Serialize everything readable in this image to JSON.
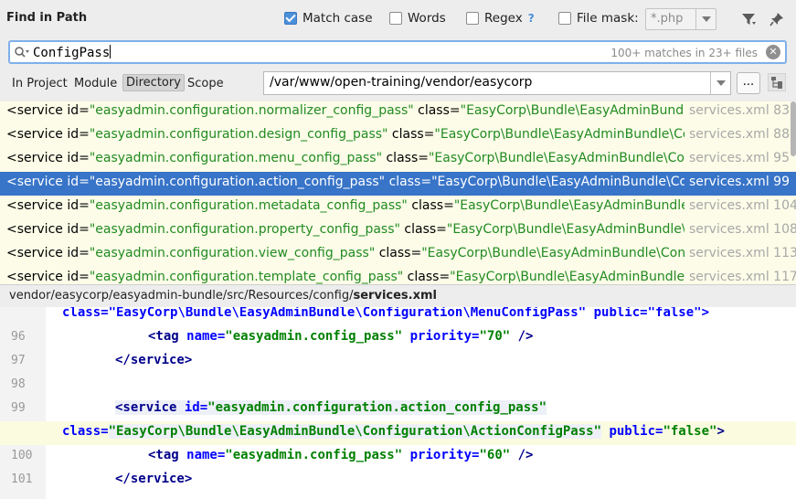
{
  "header": {
    "title": "Find in Path",
    "options": {
      "match_case": {
        "label": "Match case",
        "checked": true
      },
      "words": {
        "label": "Words",
        "checked": false
      },
      "regex": {
        "label": "Regex",
        "checked": false,
        "help": "?"
      },
      "file_mask": {
        "label": "File mask:",
        "checked": false,
        "value": "*.php"
      }
    },
    "icons": [
      "filter-icon",
      "pin-icon"
    ]
  },
  "search": {
    "query": "ConfigPass",
    "match_count": "100+ matches in 23+ files"
  },
  "scope": {
    "tabs": [
      "In Project",
      "Module",
      "Directory",
      "Scope"
    ],
    "active_tab": "Directory",
    "directory": "/var/www/open-training/vendor/easycorp",
    "browse_label": "..."
  },
  "results": [
    {
      "pre": "<service id=",
      "id": "\"easyadmin.configuration.normalizer_config_pass\"",
      "mid": " class=",
      "cls": "\"EasyCorp\\Bundle\\EasyAdminBundle\\Co",
      "file": "services.xml 83",
      "selected": false
    },
    {
      "pre": "<service id=",
      "id": "\"easyadmin.configuration.design_config_pass\"",
      "mid": " class=",
      "cls": "\"EasyCorp\\Bundle\\EasyAdminBundle\\Confi",
      "file": "services.xml 88",
      "selected": false
    },
    {
      "pre": "<service id=",
      "id": "\"easyadmin.configuration.menu_config_pass\"",
      "mid": " class=",
      "cls": "\"EasyCorp\\Bundle\\EasyAdminBundle\\Config",
      "file": "services.xml 95",
      "selected": false
    },
    {
      "pre": "<service id=",
      "id": "\"easyadmin.configuration.action_config_pass\"",
      "mid": " class=",
      "cls": "\"EasyCorp\\Bundle\\EasyAdminBundle\\Confi",
      "file": "services.xml 99",
      "selected": true
    },
    {
      "pre": "<service id=",
      "id": "\"easyadmin.configuration.metadata_config_pass\"",
      "mid": " class=",
      "cls": "\"EasyCorp\\Bundle\\EasyAdminBundle\\C",
      "file": "services.xml 104",
      "selected": false
    },
    {
      "pre": "<service id=",
      "id": "\"easyadmin.configuration.property_config_pass\"",
      "mid": " class=",
      "cls": "\"EasyCorp\\Bundle\\EasyAdminBundle\\Co",
      "file": "services.xml 108",
      "selected": false
    },
    {
      "pre": "<service id=",
      "id": "\"easyadmin.configuration.view_config_pass\"",
      "mid": " class=",
      "cls": "\"EasyCorp\\Bundle\\EasyAdminBundle\\Config",
      "file": "services.xml 113",
      "selected": false
    },
    {
      "pre": "<service id=",
      "id": "\"easyadmin.configuration.template_config_pass\"",
      "mid": " class=",
      "cls": "\"EasyCorp\\Bundle\\EasyAdminBundle\\C",
      "file": "services.xml 117",
      "selected": false
    }
  ],
  "file_path": {
    "dir": "vendor/easycorp/easyadmin-bundle/src/Resources/config/",
    "file": "services.xml"
  },
  "editor": {
    "line_top": "class=\"EasyCorp\\Bundle\\EasyAdminBundle\\Configuration\\MenuConfigPass\" public=\"false\">",
    "l96": {
      "num": "96",
      "tag": "<tag",
      "a1": " name=",
      "v1": "\"easyadmin.config_pass\"",
      "a2": " priority=",
      "v2": "\"70\"",
      "end": " />"
    },
    "l97": {
      "num": "97",
      "text": "</service>"
    },
    "l98": {
      "num": "98"
    },
    "l99": {
      "num": "99",
      "tag": "<service",
      "a1": " id=",
      "v1": "\"easyadmin.configuration.action_config_pass\""
    },
    "lcls": {
      "a1": "class=",
      "v1": "\"EasyCorp\\Bundle\\EasyAdminBundle\\Configuration\\ActionConfigPass\"",
      "a2": " public=",
      "v2": "\"false\"",
      "end": ">"
    },
    "l100": {
      "num": "100",
      "tag": "<tag",
      "a1": " name=",
      "v1": "\"easyadmin.config_pass\"",
      "a2": " priority=",
      "v2": "\"60\"",
      "end": " />"
    },
    "l101": {
      "num": "101",
      "text": "</service>"
    }
  }
}
